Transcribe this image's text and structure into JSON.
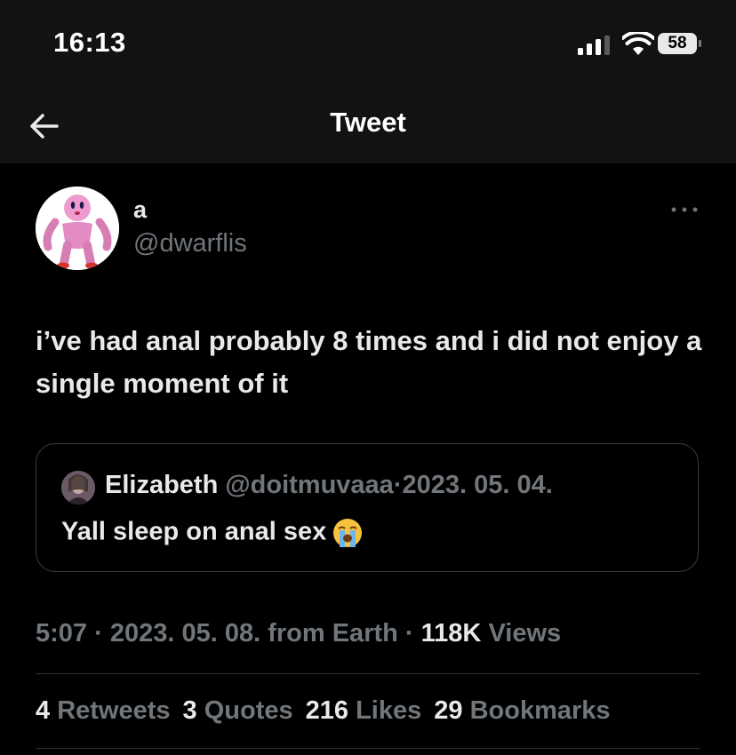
{
  "status_bar": {
    "time": "16:13",
    "battery": "58"
  },
  "nav": {
    "title": "Tweet"
  },
  "author": {
    "name": "a",
    "handle": "@dwarflis"
  },
  "tweet": {
    "text": "i’ve had anal probably 8 times and i did not enjoy a single moment of it"
  },
  "quoted": {
    "name": "Elizabeth",
    "handle": "@doitmuvaaa",
    "date": "2023. 05. 04.",
    "text": "Yall sleep on anal sex",
    "emoji": "loudly-crying-face-icon"
  },
  "meta": {
    "time": "5:07",
    "date": "2023. 05. 08.",
    "location": "from Earth",
    "views_count": "118K",
    "views_label": "Views"
  },
  "stats": [
    {
      "count": "4",
      "label": "Retweets"
    },
    {
      "count": "3",
      "label": "Quotes"
    },
    {
      "count": "216",
      "label": "Likes"
    },
    {
      "count": "29",
      "label": "Bookmarks"
    }
  ]
}
